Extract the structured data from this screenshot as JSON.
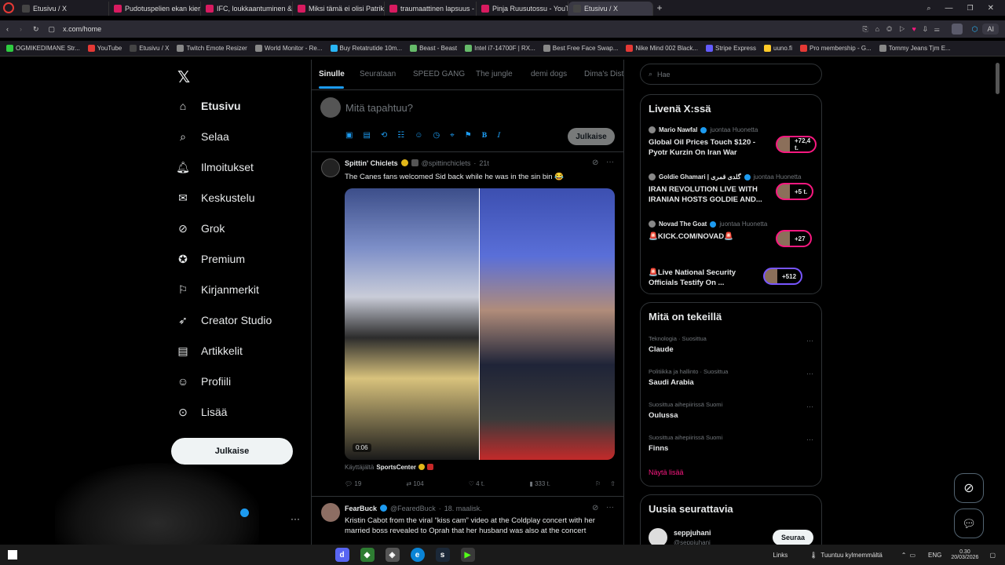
{
  "browser": {
    "tabs": [
      {
        "label": "Etusivu / X",
        "color": "#444"
      },
      {
        "label": "Pudotuspelien ekan kierro",
        "color": "#d81b60"
      },
      {
        "label": "IFC, loukkaantuminen & V",
        "color": "#d81b60"
      },
      {
        "label": "Miksi tämä ei olisi Patrik L",
        "color": "#d81b60"
      },
      {
        "label": "traumaattinen lapsuus - Y",
        "color": "#d81b60"
      },
      {
        "label": "Pinja Ruusutossu - YouTu",
        "color": "#d81b60"
      },
      {
        "label": "Etusivu / X",
        "color": "#444"
      }
    ],
    "url": "x.com/home",
    "ai_label": "AI",
    "bookmarks": [
      {
        "label": "OGMIKEDIMANE Str...",
        "color": "#2ecc40"
      },
      {
        "label": "YouTube",
        "color": "#e53935"
      },
      {
        "label": "Etusivu / X",
        "color": "#444"
      },
      {
        "label": "Twitch Emote Resizer",
        "color": "#888"
      },
      {
        "label": "World Monitor - Re...",
        "color": "#888"
      },
      {
        "label": "Buy Retatrutide 10m...",
        "color": "#29b6f6"
      },
      {
        "label": "Beast - Beast",
        "color": "#66bb6a"
      },
      {
        "label": "Intel i7-14700F | RX...",
        "color": "#66bb6a"
      },
      {
        "label": "Best Free Face Swap...",
        "color": "#888"
      },
      {
        "label": "Nike Mind 002 Black...",
        "color": "#e53935"
      },
      {
        "label": "Stripe Express",
        "color": "#635bff"
      },
      {
        "label": "uuno.fi",
        "color": "#ffca28"
      },
      {
        "label": "Pro membership - G...",
        "color": "#e53935"
      },
      {
        "label": "Tommy Jeans Tjm E...",
        "color": "#888"
      }
    ]
  },
  "sidebar": {
    "items": [
      {
        "label": "Etusivu",
        "icon": "home-icon",
        "active": true
      },
      {
        "label": "Selaa",
        "icon": "search-icon"
      },
      {
        "label": "Ilmoitukset",
        "icon": "bell-icon"
      },
      {
        "label": "Keskustelu",
        "icon": "mail-icon"
      },
      {
        "label": "Grok",
        "icon": "grok-icon"
      },
      {
        "label": "Premium",
        "icon": "verified-icon"
      },
      {
        "label": "Kirjanmerkit",
        "icon": "bookmark-icon"
      },
      {
        "label": "Creator Studio",
        "icon": "rocket-icon"
      },
      {
        "label": "Artikkelit",
        "icon": "article-icon"
      },
      {
        "label": "Profiili",
        "icon": "person-icon"
      },
      {
        "label": "Lisää",
        "icon": "more-icon"
      }
    ],
    "post_button": "Julkaise"
  },
  "feed": {
    "tabs": [
      "Sinulle",
      "Seurataan",
      "SPEED GANG",
      "The jungle",
      "demi dogs",
      "Dima's Dist"
    ],
    "composer_placeholder": "Mitä tapahtuu?",
    "post_button": "Julkaise",
    "tweets": [
      {
        "name": "Spittin' Chiclets",
        "handle": "@spittinchiclets",
        "time": "21t",
        "text": "The Canes fans welcomed Sid back while he was in the sin bin 😂",
        "video_time": "0:06",
        "attribution_prefix": "Käyttäjältä",
        "attribution_source": "SportsCenter",
        "replies": "19",
        "retweets": "104",
        "likes": "4 t.",
        "views": "333 t."
      },
      {
        "name": "FearBuck",
        "handle": "@FearedBuck",
        "time": "18. maalisk.",
        "text": "Kristin Cabot from the viral “kiss cam” video at the Coldplay concert with her married boss revealed to Oprah that her husband was also at the concert"
      }
    ]
  },
  "search": {
    "placeholder": "Hae"
  },
  "live": {
    "title": "Livenä X:ssä",
    "items": [
      {
        "host": "Mario Nawfal",
        "suffix": "juontaa Huonetta",
        "title": "Global Oil Prices Touch $120 - Pyotr Kurzin On Iran War",
        "count": "+72,4 t.",
        "color": "#f91880"
      },
      {
        "host": "Goldie Ghamari | گلدی قمری",
        "suffix": "juontaa Huonetta",
        "title": "IRAN REVOLUTION LIVE WITH IRANIAN HOSTS GOLDIE AND...",
        "count": "+5 t.",
        "color": "#f91880"
      },
      {
        "host": "Novad The Goat",
        "suffix": "juontaa Huonetta",
        "title": "🚨KICK.COM/NOVAD🚨",
        "count": "+27",
        "color": "#f91880"
      },
      {
        "host": "",
        "suffix": "",
        "title": "🚨Live National Security Officials Testify On ...",
        "count": "+512",
        "color": "#7856ff"
      }
    ]
  },
  "trends": {
    "title": "Mitä on tekeillä",
    "items": [
      {
        "context": "Teknologia · Suosittua",
        "name": "Claude"
      },
      {
        "context": "Politiikka ja hallinto · Suosittua",
        "name": "Saudi Arabia"
      },
      {
        "context": "Suosittua aihepiirissä Suomi",
        "name": "Oulussa"
      },
      {
        "context": "Suosittua aihepiirissä Suomi",
        "name": "Finns"
      }
    ],
    "show_more": "Näytä lisää"
  },
  "who_to_follow": {
    "title": "Uusia seurattavia",
    "user": "seppjuhani",
    "handle": "@seppjuhani",
    "follow": "Seuraa"
  },
  "taskbar": {
    "links": "Links",
    "weather": "Tuuntuu kylmemmältä",
    "lang": "ENG",
    "time": "0.30",
    "date": "20/03/2026"
  },
  "colors": {
    "accent": "#1d9bf0",
    "pink": "#f91880",
    "bg": "#000000"
  }
}
